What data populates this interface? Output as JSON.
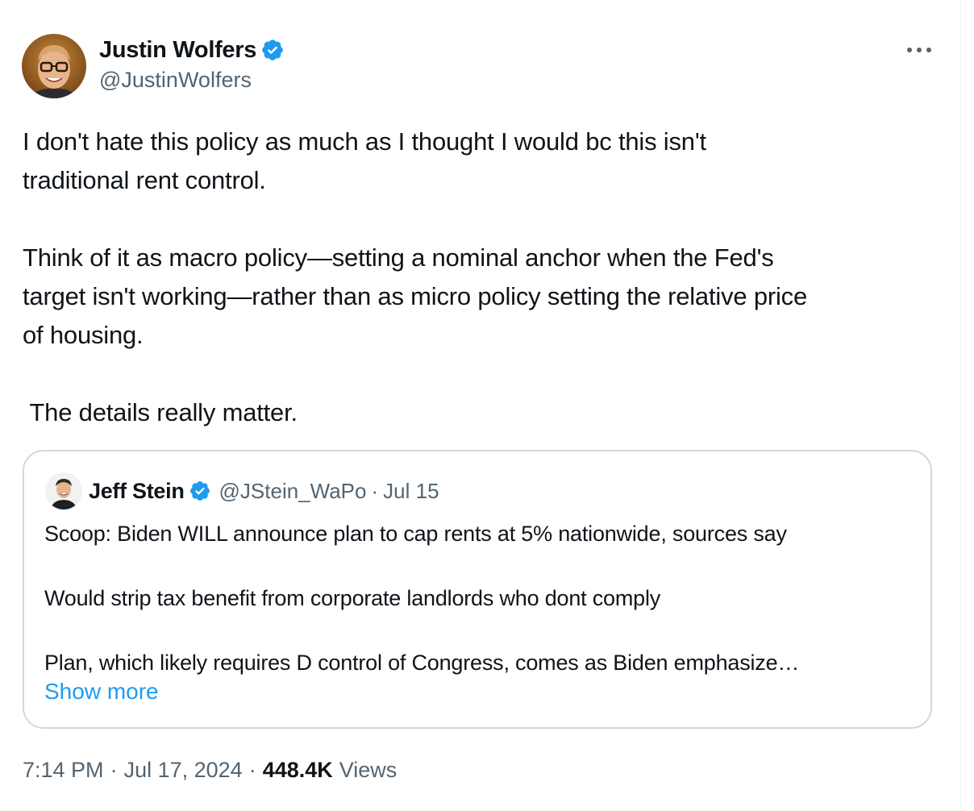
{
  "author": {
    "name": "Justin Wolfers",
    "handle": "@JustinWolfers",
    "verified": true,
    "avatar": "avatar-photo"
  },
  "more_icon": "more-horizontal-icon",
  "tweet": {
    "text": "I don't hate this policy as much as I thought I would bc this isn't\ntraditional rent control.\n\nThink of it as macro policy—setting a nominal anchor when the Fed's\ntarget isn't working—rather than as micro policy setting the relative price\nof housing.\n\n The details really matter."
  },
  "quote": {
    "name": "Jeff Stein",
    "handle": "@JStein_WaPo",
    "separator": "·",
    "date": "Jul 15",
    "verified": true,
    "text": "Scoop: Biden WILL announce plan to cap rents at 5% nationwide, sources say\n\nWould strip tax benefit from corporate landlords who dont comply\n\nPlan, which likely requires D control of Congress, comes as Biden emphasize…",
    "show_more": "Show more"
  },
  "meta": {
    "time": "7:14 PM",
    "separator": "·",
    "date": "Jul 17, 2024",
    "views_count": "448.4K",
    "views_label": "Views"
  },
  "colors": {
    "accent": "#1d9bf0",
    "text": "#0f1419",
    "secondary": "#536471",
    "border": "#cfd9de"
  }
}
